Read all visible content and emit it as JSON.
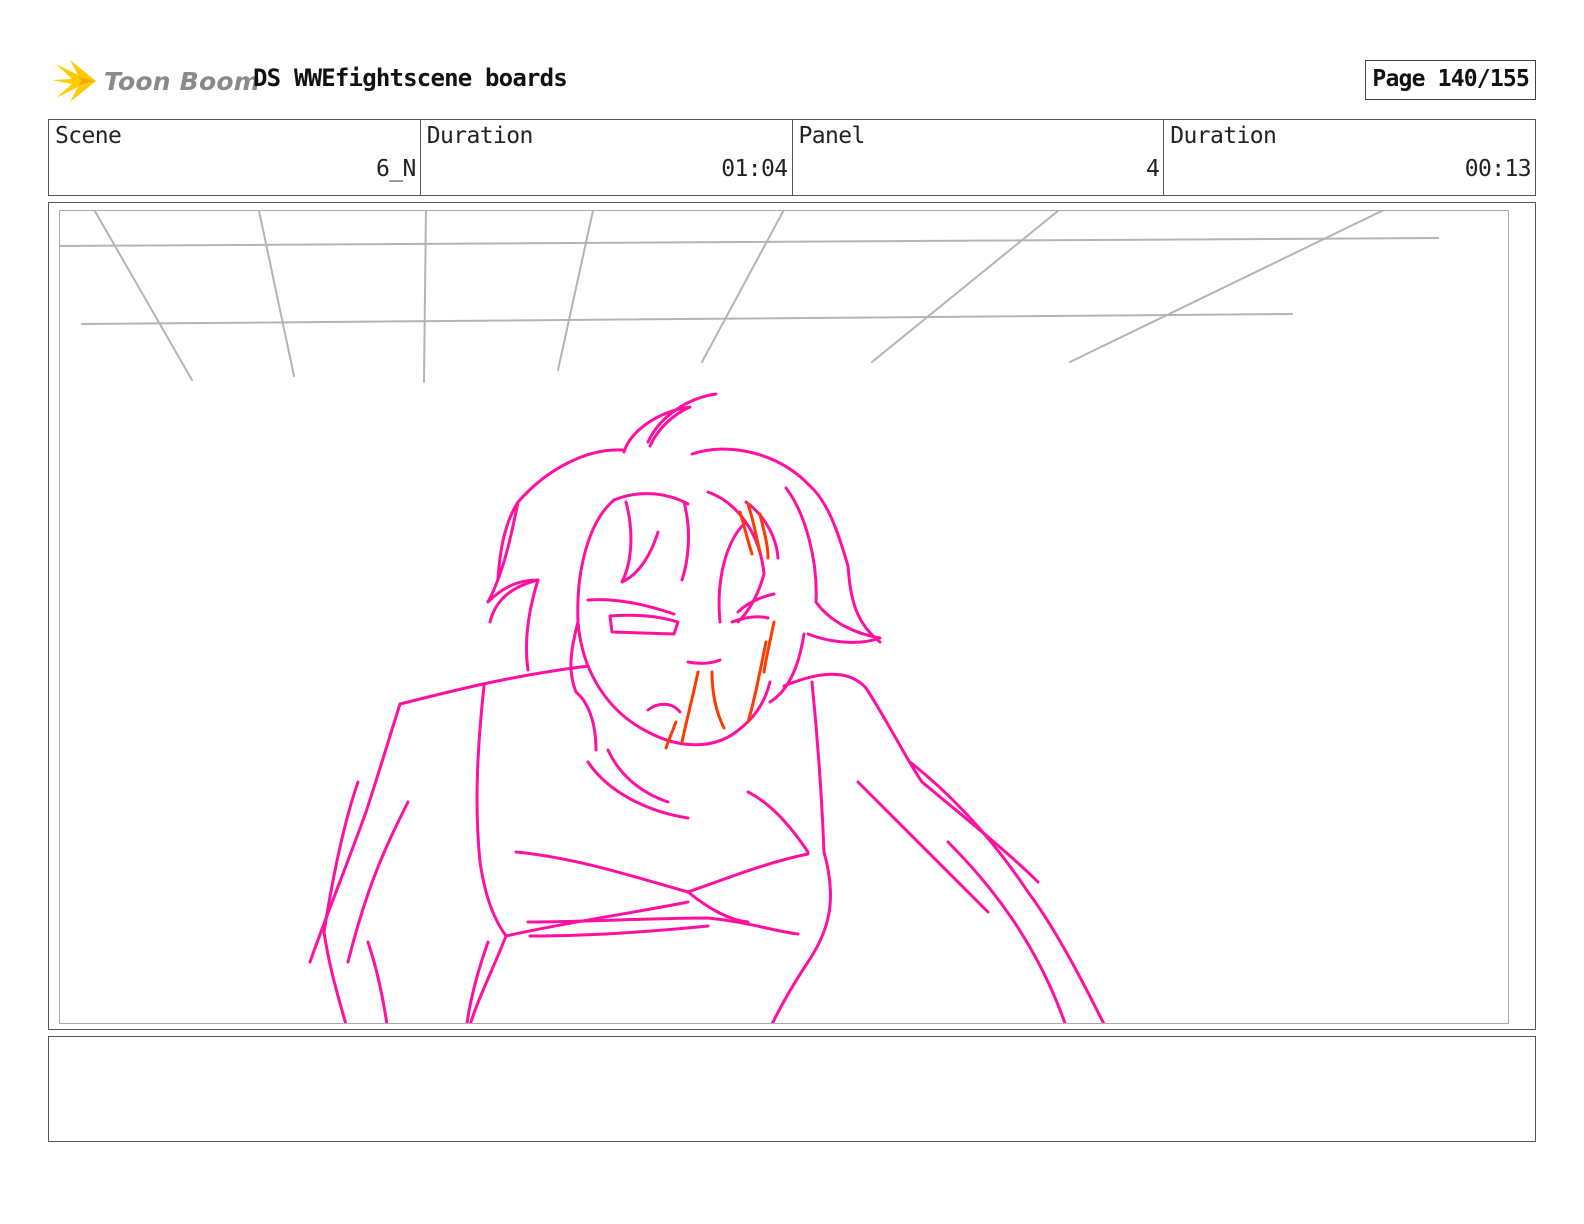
{
  "header": {
    "logo_text": "Toon Boom",
    "title": "DS WWEfightscene boards",
    "page_label": "Page 140/155"
  },
  "info": {
    "scene_label": "Scene",
    "scene_value": "6_N",
    "scene_duration_label": "Duration",
    "scene_duration_value": "01:04",
    "panel_label": "Panel",
    "panel_value": "4",
    "panel_duration_label": "Duration",
    "panel_duration_value": "00:13"
  },
  "colors": {
    "sketch_primary": "#ff10a0",
    "sketch_blood": "#ff3a00",
    "perspective_lines": "#b4b4b4",
    "logo_star": "#ffcc00"
  },
  "notes": {
    "text": ""
  }
}
